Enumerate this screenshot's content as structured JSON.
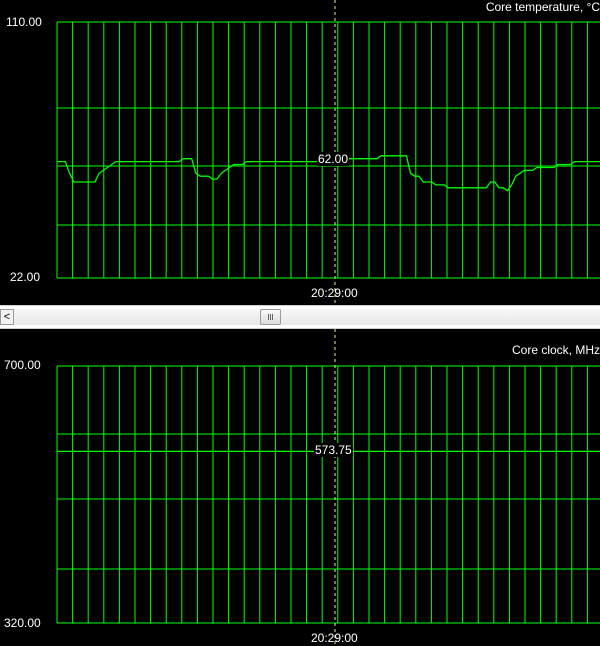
{
  "chart_data": [
    {
      "type": "line",
      "title": "Core temperature, °C",
      "ylim": [
        22,
        110
      ],
      "y_top_label": "110.00",
      "y_bottom_label": "22.00",
      "cursor_time": "20:29:00",
      "cursor_value": "62.00",
      "grid": true,
      "color": "#00ff00",
      "series": [
        {
          "values": [
            62,
            62,
            62,
            58,
            55,
            55,
            55,
            55,
            55,
            55,
            58,
            59,
            60,
            61,
            62,
            62,
            62,
            62,
            62,
            62,
            62,
            62,
            62,
            62,
            62,
            62,
            62,
            62,
            62,
            62,
            63,
            63,
            63,
            58,
            57,
            57,
            57,
            56,
            56,
            58,
            59,
            60,
            61,
            61,
            61,
            62,
            62,
            62,
            62,
            62,
            62,
            62,
            62,
            62,
            62,
            62,
            62,
            62,
            62,
            62,
            62,
            62,
            62,
            62,
            62,
            62,
            62,
            63,
            63,
            63,
            63,
            63,
            63,
            63,
            63,
            63,
            63,
            64,
            64,
            64,
            64,
            64,
            64,
            64,
            58,
            57,
            57,
            55,
            55,
            55,
            54,
            54,
            54,
            53,
            53,
            53,
            53,
            53,
            53,
            53,
            53,
            53,
            53,
            55,
            55,
            53,
            53,
            52,
            54,
            57,
            58,
            59,
            59,
            59,
            60,
            60,
            60,
            60,
            60,
            61,
            61,
            61,
            61,
            62,
            62,
            62,
            62,
            62,
            62,
            62
          ]
        }
      ]
    },
    {
      "type": "line",
      "title": "Core clock, MHz",
      "ylim": [
        320,
        700
      ],
      "y_top_label": "700.00",
      "y_bottom_label": "320.00",
      "cursor_time": "20:29:00",
      "cursor_value": "573.75",
      "grid": true,
      "color": "#00ff00",
      "series": [
        {
          "values": [
            573.75,
            573.75
          ]
        }
      ]
    }
  ],
  "scrollbar": {
    "left_arrow": "<",
    "position_fraction": 0.45
  }
}
